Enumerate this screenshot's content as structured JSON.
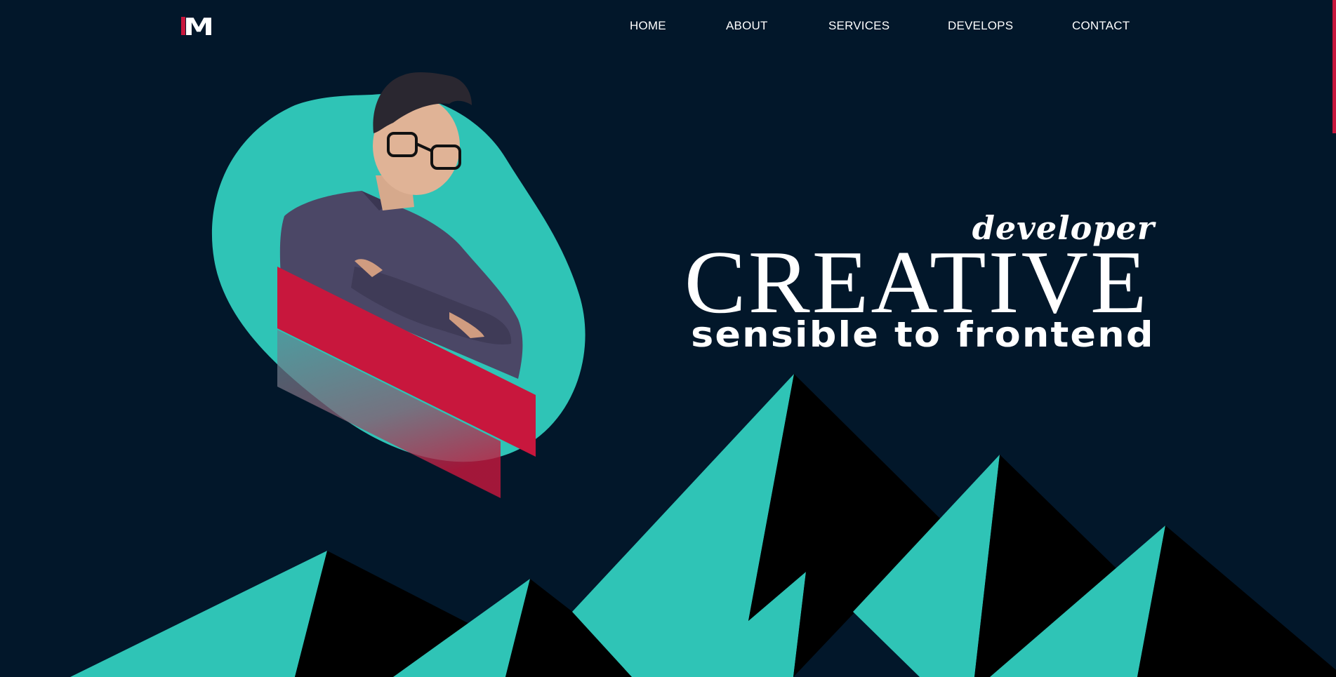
{
  "brand": {
    "logo_text": "M",
    "accent_color": "#c8173d"
  },
  "nav": {
    "items": [
      {
        "label": "HOME"
      },
      {
        "label": "ABOUT"
      },
      {
        "label": "SERVICES"
      },
      {
        "label": "DEVELOPS"
      },
      {
        "label": "CONTACT"
      }
    ]
  },
  "hero": {
    "tagline_top": "developer",
    "title": "CREATIVE",
    "tagline_bottom": "sensible to frontend",
    "portrait_icon": "person-portrait"
  },
  "colors": {
    "background": "#02172a",
    "teal": "#2fc4b6",
    "crimson": "#c8173d",
    "mountain_shadow": "#000000",
    "text": "#ffffff"
  }
}
